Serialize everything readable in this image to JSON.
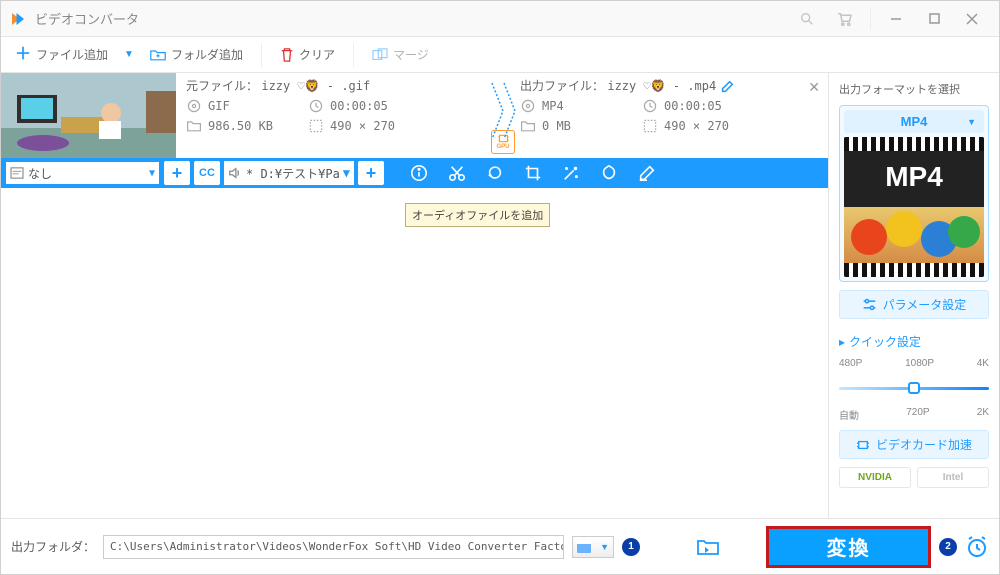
{
  "window": {
    "title": "ビデオコンバータ"
  },
  "toolbar": {
    "add_file": "ファイル追加",
    "add_folder": "フォルダ追加",
    "clear": "クリア",
    "merge": "マージ"
  },
  "item": {
    "source": {
      "label": "元ファイル：",
      "filename": "izzy ♡🦁 - .gif",
      "format": "GIF",
      "duration": "00:00:05",
      "size": "986.50 KB",
      "dimensions": "490 × 270"
    },
    "output": {
      "label": "出力ファイル：",
      "filename": "izzy ♡🦁 - .mp4",
      "format": "MP4",
      "duration": "00:00:05",
      "size": "0 MB",
      "dimensions": "490 × 270"
    },
    "gpu_label": "GPU",
    "subtitle_value": "なし",
    "audio_value": "* D:¥テスト¥Pack",
    "tooltip": "オーディオファイルを追加"
  },
  "right": {
    "title": "出力フォーマットを選択",
    "format": "MP4",
    "format_big": "MP4",
    "param_btn": "パラメータ設定",
    "quick_label": "クイック設定",
    "scale_top": [
      "480P",
      "1080P",
      "4K"
    ],
    "scale_bot": [
      "自動",
      "720P",
      "2K"
    ],
    "gpu_accel": "ビデオカード加速",
    "vendors": [
      "NVIDIA",
      "Intel"
    ]
  },
  "bottom": {
    "label": "出力フォルダ：",
    "path": "C:\\Users\\Administrator\\Videos\\WonderFox Soft\\HD Video Converter Factory Pro\\OutputVideo\\",
    "callout1": "1",
    "callout2": "2",
    "convert": "変換"
  }
}
